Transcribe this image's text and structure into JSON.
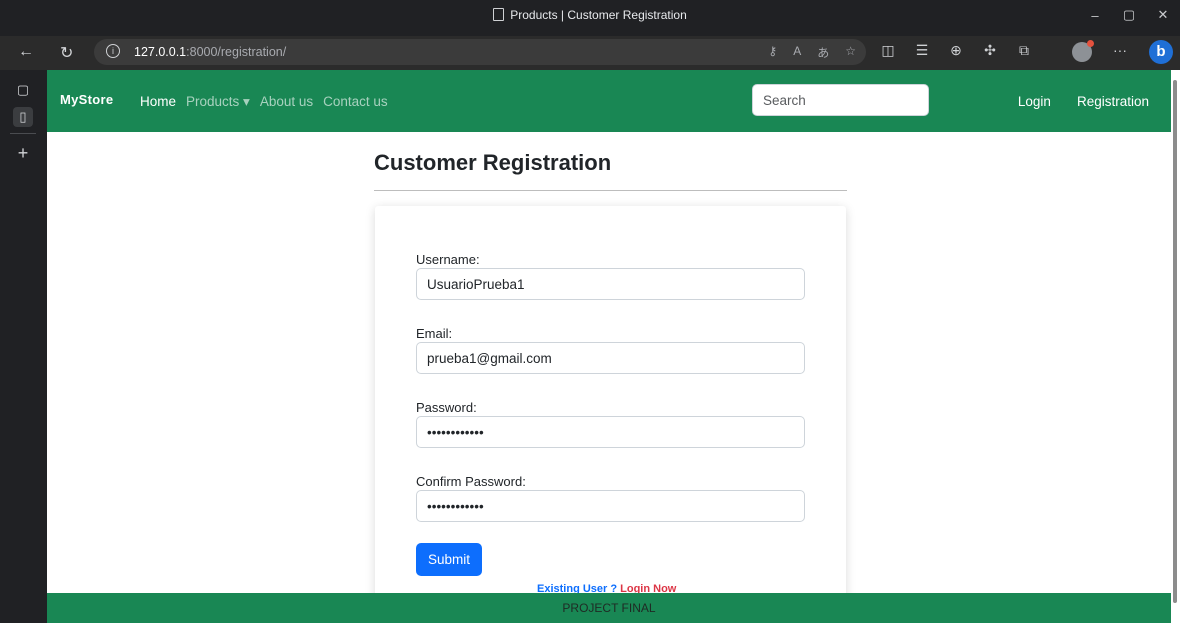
{
  "window": {
    "title": "Products | Customer Registration",
    "controls": {
      "minimize": "–",
      "restore": "▢",
      "close": "✕"
    }
  },
  "toolbar": {
    "url_host": "127.0.0.1",
    "url_rest": ":8000/registration/",
    "more_label": "···",
    "copilot_label": "b"
  },
  "navbar": {
    "brand": "MyStore",
    "links": [
      {
        "label": "Home"
      },
      {
        "label": "Products ▾"
      },
      {
        "label": "About us"
      },
      {
        "label": "Contact us"
      }
    ],
    "search_placeholder": "Search",
    "right_links": [
      {
        "label": "Login"
      },
      {
        "label": "Registration"
      }
    ]
  },
  "registration": {
    "heading": "Customer Registration",
    "fields": [
      {
        "label": "Username:",
        "value": "UsuarioPrueba1",
        "type": "text"
      },
      {
        "label": "Email:",
        "value": "prueba1@gmail.com",
        "type": "email"
      },
      {
        "label": "Password:",
        "value": "************",
        "type": "password"
      },
      {
        "label": "Confirm Password:",
        "value": "************",
        "type": "password"
      }
    ],
    "submit_label": "Submit",
    "existing_user_text": "Existing User ?",
    "login_now_text": "Login Now"
  },
  "footer": {
    "text": "PROJECT FINAL"
  },
  "colors": {
    "navbar_bg": "#198754",
    "primary_button": "#0d6efd",
    "login_link": "#dc3545"
  }
}
